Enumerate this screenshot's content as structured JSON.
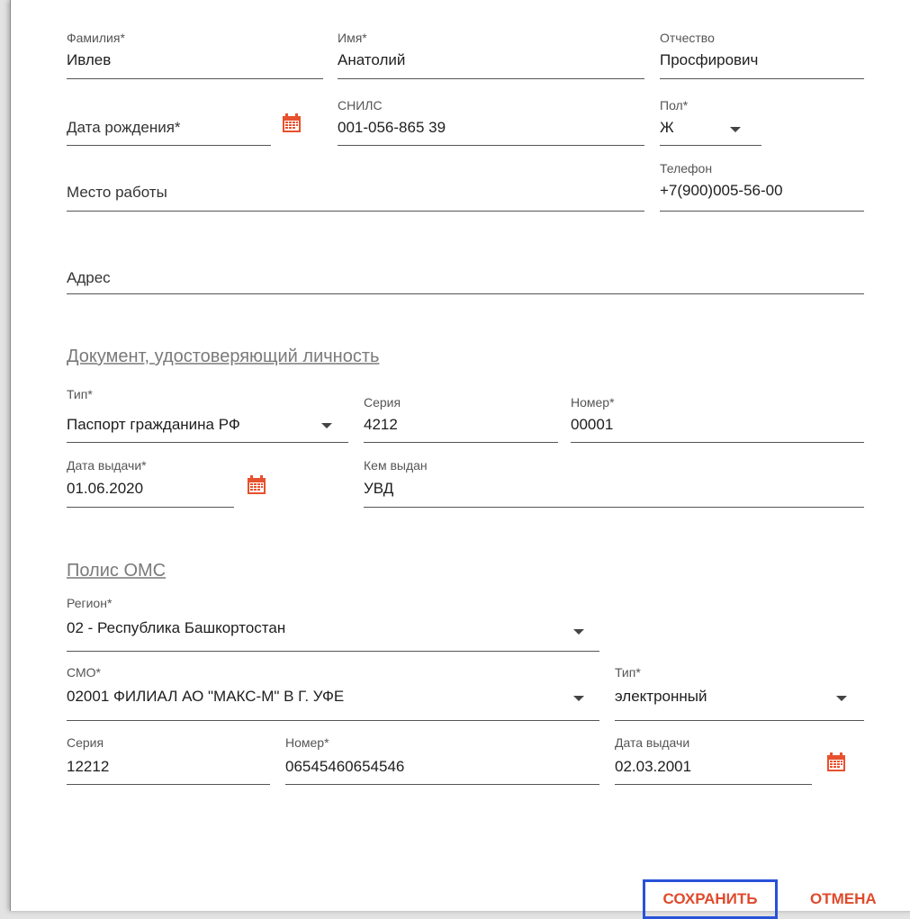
{
  "person": {
    "last_name": {
      "label": "Фамилия*",
      "value": "Ивлев"
    },
    "first_name": {
      "label": "Имя*",
      "value": "Анатолий"
    },
    "patronymic": {
      "label": "Отчество",
      "value": "Просфирович"
    },
    "birth_date": {
      "placeholder": "Дата рождения*"
    },
    "snils": {
      "label": "СНИЛС",
      "value": "001-056-865 39"
    },
    "sex": {
      "label": "Пол*",
      "value": "Ж"
    },
    "workplace": {
      "placeholder": "Место работы"
    },
    "phone": {
      "label": "Телефон",
      "value": "+7(900)005-56-00"
    },
    "address": {
      "placeholder": "Адрес"
    }
  },
  "id_document": {
    "section_title": "Документ, удостоверяющий личность",
    "type": {
      "label": "Тип*",
      "value": "Паспорт гражданина РФ"
    },
    "series": {
      "label": "Серия",
      "value": "4212"
    },
    "number": {
      "label": "Номер*",
      "value": "00001"
    },
    "issue_date": {
      "label": "Дата выдачи*",
      "value": "01.06.2020"
    },
    "issued_by": {
      "label": "Кем выдан",
      "value": "УВД"
    }
  },
  "oms_policy": {
    "section_title": "Полис ОМС",
    "region": {
      "label": "Регион*",
      "value": "02 - Республика Башкортостан"
    },
    "smo": {
      "label": "СМО*",
      "value": "02001 ФИЛИАЛ АО \"МАКС-М\" В Г. УФЕ"
    },
    "type": {
      "label": "Тип*",
      "value": "электронный"
    },
    "series": {
      "label": "Серия",
      "value": "12212"
    },
    "number": {
      "label": "Номер*",
      "value": "06545460654546"
    },
    "issue_date": {
      "label": "Дата выдачи",
      "value": "02.03.2001"
    }
  },
  "actions": {
    "save_label": "СОХРАНИТЬ",
    "cancel_label": "ОТМЕНА"
  },
  "colors": {
    "accent": "#e04a2c",
    "focus_border": "#2852d8",
    "calendar_icon": "#e8512e"
  }
}
